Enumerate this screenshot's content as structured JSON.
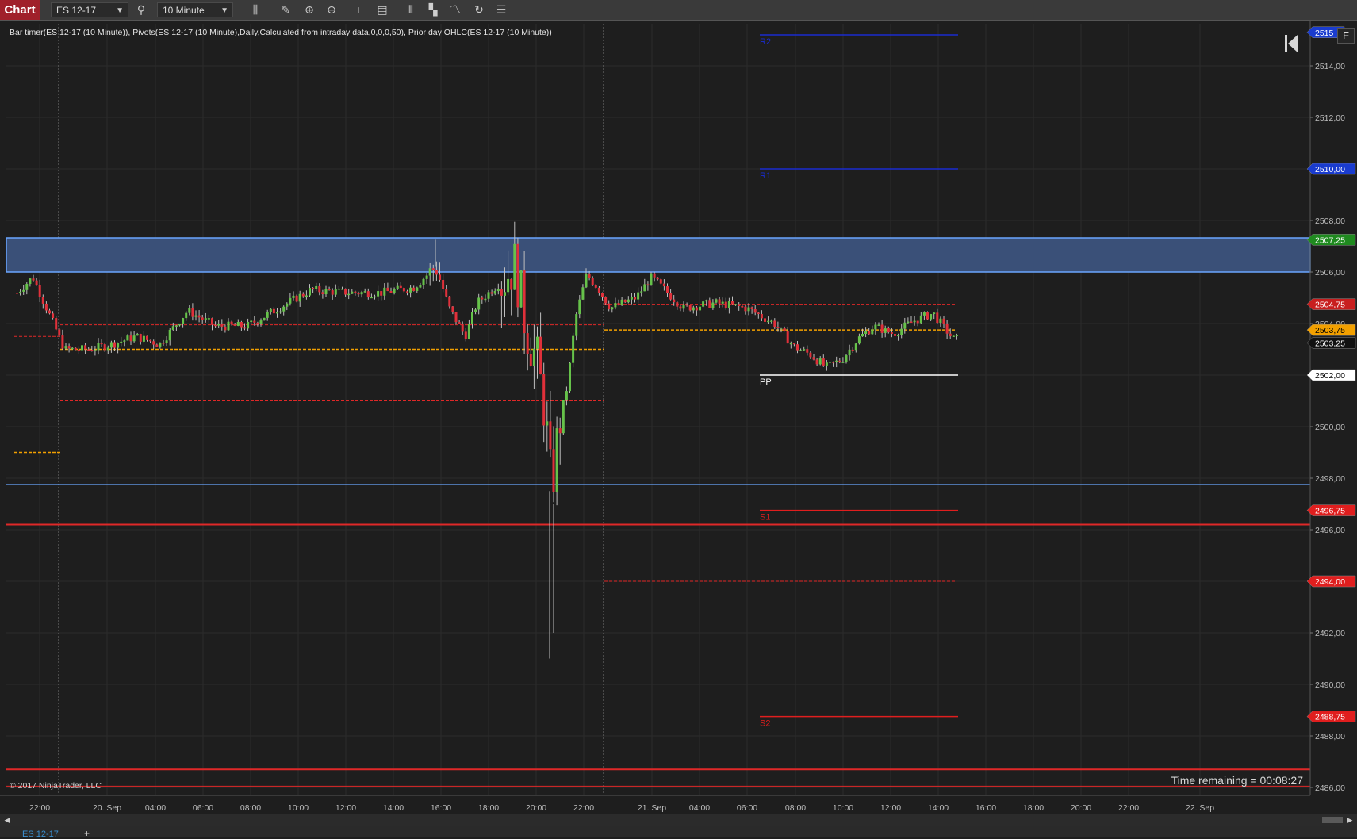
{
  "toolbar": {
    "chart_tab": "Chart",
    "instrument": "ES 12-17",
    "interval": "10 Minute",
    "icons": [
      "search-icon",
      "bar-style-icon",
      "draw-pencil-icon",
      "zoom-in-icon",
      "zoom-out-icon",
      "crosshair-icon",
      "data-box-icon",
      "chart-trader-icon",
      "strategies-icon",
      "indicators-icon",
      "reload-icon",
      "properties-icon"
    ]
  },
  "chart": {
    "indicator_label": "Bar timer(ES 12-17 (10 Minute)), Pivots(ES 12-17 (10 Minute),Daily,Calculated from intraday data,0,0,0,50), Prior day OHLC(ES 12-17 (10 Minute))",
    "copyright": "© 2017 NinjaTrader, LLC",
    "time_remaining": "Time remaining = 00:08:27",
    "f_button": "F",
    "price_axis_ticks": [
      "2514,00",
      "2512,00",
      "2508,00",
      "2506,00",
      "2504,00",
      "2500,00",
      "2498,00",
      "2496,00",
      "2492,00",
      "2490,00",
      "2488,00",
      "2486,00"
    ],
    "time_axis_ticks": [
      "22:00",
      "20. Sep",
      "04:00",
      "06:00",
      "08:00",
      "10:00",
      "12:00",
      "14:00",
      "16:00",
      "18:00",
      "20:00",
      "22:00",
      "21. Sep",
      "04:00",
      "06:00",
      "08:00",
      "10:00",
      "12:00",
      "14:00",
      "16:00",
      "18:00",
      "20:00",
      "22:00",
      "22. Sep"
    ],
    "price_markers": [
      {
        "value": "2515",
        "color": "#1a3ccf",
        "text": "#ffffff"
      },
      {
        "value": "2510,00",
        "color": "#1a3ccf",
        "text": "#ffffff"
      },
      {
        "value": "2507,25",
        "color": "#1f8a1f",
        "text": "#ffffff"
      },
      {
        "value": "2504,75",
        "color": "#c81e1e",
        "text": "#ffffff"
      },
      {
        "value": "2503,75",
        "color": "#f2a000",
        "text": "#000000"
      },
      {
        "value": "2503,25",
        "color": "#111111",
        "text": "#ffffff"
      },
      {
        "value": "2502,00",
        "color": "#ffffff",
        "text": "#000000"
      },
      {
        "value": "2496,75",
        "color": "#e01e1e",
        "text": "#ffffff"
      },
      {
        "value": "2494,00",
        "color": "#e01e1e",
        "text": "#ffffff"
      },
      {
        "value": "2488,75",
        "color": "#e01e1e",
        "text": "#ffffff"
      }
    ],
    "pivot_labels": {
      "r2": "R2",
      "r1": "R1",
      "pp": "PP",
      "s1": "S1",
      "s2": "S2"
    },
    "colors": {
      "up": "#66c24a",
      "down": "#e0303a",
      "pivot_resistance": "#1a2ccf",
      "pivot_support": "#e01e1e",
      "pivot_pp": "#ffffff",
      "zone_fill": "#3a5078",
      "zone_border": "#6aa6ff",
      "prior_orange": "#f2a000",
      "prior_red": "#e02828"
    }
  },
  "bottom": {
    "instrument_tab": "ES 12-17",
    "add_tab": "+"
  }
}
